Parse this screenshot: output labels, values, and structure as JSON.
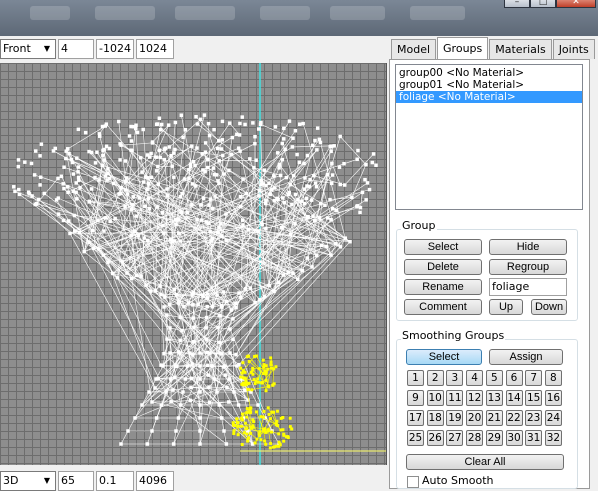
{
  "toolbar_top": {
    "view_select": "Front",
    "field1": "4",
    "field2": "-1024",
    "field3": "1024"
  },
  "toolbar_bottom": {
    "view_select": "3D",
    "field1": "65",
    "field2": "0.1",
    "field3": "4096"
  },
  "tabs": [
    {
      "label": "Model",
      "active": false
    },
    {
      "label": "Groups",
      "active": true
    },
    {
      "label": "Materials",
      "active": false
    },
    {
      "label": "Joints",
      "active": false
    }
  ],
  "groups_list": [
    {
      "label": "group00 <No Material>",
      "selected": false
    },
    {
      "label": "group01 <No Material>",
      "selected": false
    },
    {
      "label": "foliage <No Material>",
      "selected": true
    }
  ],
  "group_section": {
    "title": "Group",
    "select_label": "Select",
    "hide_label": "Hide",
    "delete_label": "Delete",
    "regroup_label": "Regroup",
    "rename_label": "Rename",
    "name_value": "foliage",
    "comment_label": "Comment",
    "up_label": "Up",
    "down_label": "Down"
  },
  "smoothing_section": {
    "title": "Smoothing Groups",
    "select_label": "Select",
    "assign_label": "Assign",
    "numbers": [
      "1",
      "2",
      "3",
      "4",
      "5",
      "6",
      "7",
      "8",
      "9",
      "10",
      "11",
      "12",
      "13",
      "14",
      "15",
      "16",
      "17",
      "18",
      "19",
      "20",
      "21",
      "22",
      "23",
      "24",
      "25",
      "26",
      "27",
      "28",
      "29",
      "30",
      "31",
      "32"
    ],
    "clear_all_label": "Clear All",
    "auto_smooth_label": "Auto Smooth"
  },
  "colors": {
    "viewport_bg": "#8e8e8e",
    "wireframe": "#ffffff",
    "selection": "#ffff00",
    "axis": "#40e0e0",
    "list_selection": "#3399ff"
  }
}
